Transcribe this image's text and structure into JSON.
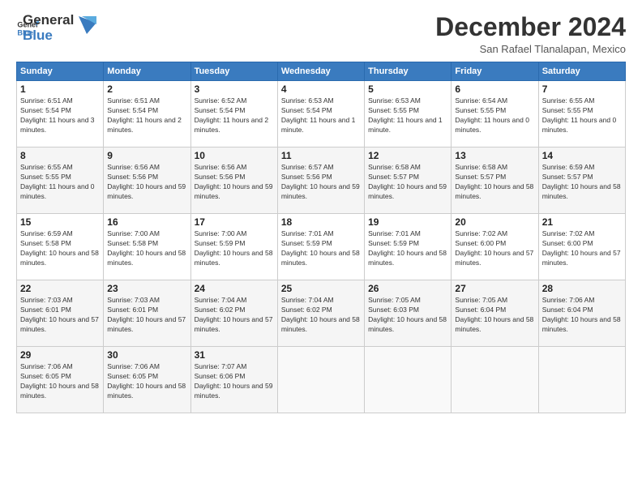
{
  "logo": {
    "general": "General",
    "blue": "Blue"
  },
  "header": {
    "title": "December 2024",
    "location": "San Rafael Tlanalapan, Mexico"
  },
  "weekdays": [
    "Sunday",
    "Monday",
    "Tuesday",
    "Wednesday",
    "Thursday",
    "Friday",
    "Saturday"
  ],
  "weeks": [
    [
      {
        "day": "1",
        "sunrise": "6:51 AM",
        "sunset": "5:54 PM",
        "daylight": "11 hours and 3 minutes."
      },
      {
        "day": "2",
        "sunrise": "6:51 AM",
        "sunset": "5:54 PM",
        "daylight": "11 hours and 2 minutes."
      },
      {
        "day": "3",
        "sunrise": "6:52 AM",
        "sunset": "5:54 PM",
        "daylight": "11 hours and 2 minutes."
      },
      {
        "day": "4",
        "sunrise": "6:53 AM",
        "sunset": "5:54 PM",
        "daylight": "11 hours and 1 minute."
      },
      {
        "day": "5",
        "sunrise": "6:53 AM",
        "sunset": "5:55 PM",
        "daylight": "11 hours and 1 minute."
      },
      {
        "day": "6",
        "sunrise": "6:54 AM",
        "sunset": "5:55 PM",
        "daylight": "11 hours and 0 minutes."
      },
      {
        "day": "7",
        "sunrise": "6:55 AM",
        "sunset": "5:55 PM",
        "daylight": "11 hours and 0 minutes."
      }
    ],
    [
      {
        "day": "8",
        "sunrise": "6:55 AM",
        "sunset": "5:55 PM",
        "daylight": "11 hours and 0 minutes."
      },
      {
        "day": "9",
        "sunrise": "6:56 AM",
        "sunset": "5:56 PM",
        "daylight": "10 hours and 59 minutes."
      },
      {
        "day": "10",
        "sunrise": "6:56 AM",
        "sunset": "5:56 PM",
        "daylight": "10 hours and 59 minutes."
      },
      {
        "day": "11",
        "sunrise": "6:57 AM",
        "sunset": "5:56 PM",
        "daylight": "10 hours and 59 minutes."
      },
      {
        "day": "12",
        "sunrise": "6:58 AM",
        "sunset": "5:57 PM",
        "daylight": "10 hours and 59 minutes."
      },
      {
        "day": "13",
        "sunrise": "6:58 AM",
        "sunset": "5:57 PM",
        "daylight": "10 hours and 58 minutes."
      },
      {
        "day": "14",
        "sunrise": "6:59 AM",
        "sunset": "5:57 PM",
        "daylight": "10 hours and 58 minutes."
      }
    ],
    [
      {
        "day": "15",
        "sunrise": "6:59 AM",
        "sunset": "5:58 PM",
        "daylight": "10 hours and 58 minutes."
      },
      {
        "day": "16",
        "sunrise": "7:00 AM",
        "sunset": "5:58 PM",
        "daylight": "10 hours and 58 minutes."
      },
      {
        "day": "17",
        "sunrise": "7:00 AM",
        "sunset": "5:59 PM",
        "daylight": "10 hours and 58 minutes."
      },
      {
        "day": "18",
        "sunrise": "7:01 AM",
        "sunset": "5:59 PM",
        "daylight": "10 hours and 58 minutes."
      },
      {
        "day": "19",
        "sunrise": "7:01 AM",
        "sunset": "5:59 PM",
        "daylight": "10 hours and 58 minutes."
      },
      {
        "day": "20",
        "sunrise": "7:02 AM",
        "sunset": "6:00 PM",
        "daylight": "10 hours and 57 minutes."
      },
      {
        "day": "21",
        "sunrise": "7:02 AM",
        "sunset": "6:00 PM",
        "daylight": "10 hours and 57 minutes."
      }
    ],
    [
      {
        "day": "22",
        "sunrise": "7:03 AM",
        "sunset": "6:01 PM",
        "daylight": "10 hours and 57 minutes."
      },
      {
        "day": "23",
        "sunrise": "7:03 AM",
        "sunset": "6:01 PM",
        "daylight": "10 hours and 57 minutes."
      },
      {
        "day": "24",
        "sunrise": "7:04 AM",
        "sunset": "6:02 PM",
        "daylight": "10 hours and 57 minutes."
      },
      {
        "day": "25",
        "sunrise": "7:04 AM",
        "sunset": "6:02 PM",
        "daylight": "10 hours and 58 minutes."
      },
      {
        "day": "26",
        "sunrise": "7:05 AM",
        "sunset": "6:03 PM",
        "daylight": "10 hours and 58 minutes."
      },
      {
        "day": "27",
        "sunrise": "7:05 AM",
        "sunset": "6:04 PM",
        "daylight": "10 hours and 58 minutes."
      },
      {
        "day": "28",
        "sunrise": "7:06 AM",
        "sunset": "6:04 PM",
        "daylight": "10 hours and 58 minutes."
      }
    ],
    [
      {
        "day": "29",
        "sunrise": "7:06 AM",
        "sunset": "6:05 PM",
        "daylight": "10 hours and 58 minutes."
      },
      {
        "day": "30",
        "sunrise": "7:06 AM",
        "sunset": "6:05 PM",
        "daylight": "10 hours and 58 minutes."
      },
      {
        "day": "31",
        "sunrise": "7:07 AM",
        "sunset": "6:06 PM",
        "daylight": "10 hours and 59 minutes."
      },
      null,
      null,
      null,
      null
    ]
  ],
  "labels": {
    "sunrise": "Sunrise:",
    "sunset": "Sunset:",
    "daylight": "Daylight:"
  }
}
